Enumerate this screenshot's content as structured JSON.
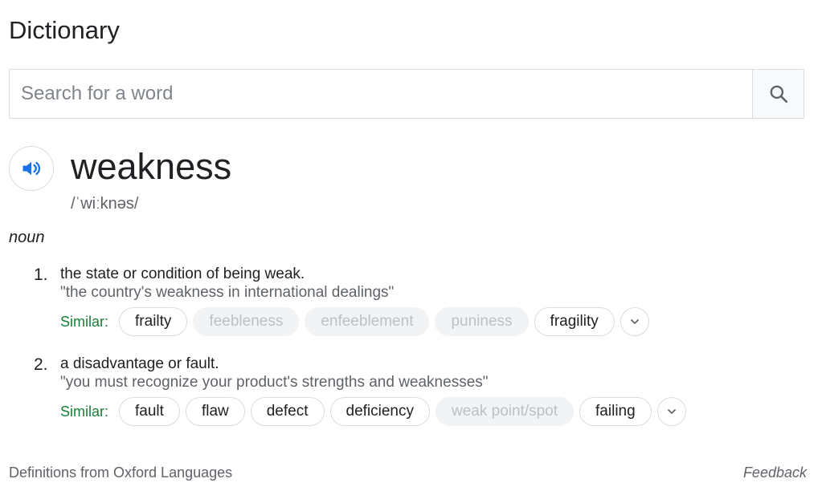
{
  "header": {
    "title": "Dictionary"
  },
  "search": {
    "placeholder": "Search for a word",
    "value": "",
    "icon": "search-icon"
  },
  "entry": {
    "word": "weakness",
    "pronunciation": "/ˈwiːknəs/",
    "audio_icon": "speaker-icon",
    "part_of_speech": "noun",
    "senses": [
      {
        "number": "1.",
        "definition": "the state or condition of being weak.",
        "example": "\"the country's weakness in international dealings\"",
        "similar_label": "Similar:",
        "similar": [
          {
            "label": "frailty",
            "dim": false
          },
          {
            "label": "feebleness",
            "dim": true
          },
          {
            "label": "enfeeblement",
            "dim": true
          },
          {
            "label": "puniness",
            "dim": true
          },
          {
            "label": "fragility",
            "dim": false
          }
        ]
      },
      {
        "number": "2.",
        "definition": "a disadvantage or fault.",
        "example": "\"you must recognize your product's strengths and weaknesses\"",
        "similar_label": "Similar:",
        "similar": [
          {
            "label": "fault",
            "dim": false
          },
          {
            "label": "flaw",
            "dim": false
          },
          {
            "label": "defect",
            "dim": false
          },
          {
            "label": "deficiency",
            "dim": false
          },
          {
            "label": "weak point/spot",
            "dim": true
          },
          {
            "label": "failing",
            "dim": false
          }
        ]
      }
    ]
  },
  "footer": {
    "source": "Definitions from Oxford Languages",
    "feedback": "Feedback"
  },
  "colors": {
    "accent": "#1a73e8",
    "similar_label": "#188038",
    "text": "#202124",
    "muted": "#5f6368",
    "dim_chip_bg": "#f1f3f4",
    "dim_chip_text": "#bdc1c6"
  }
}
